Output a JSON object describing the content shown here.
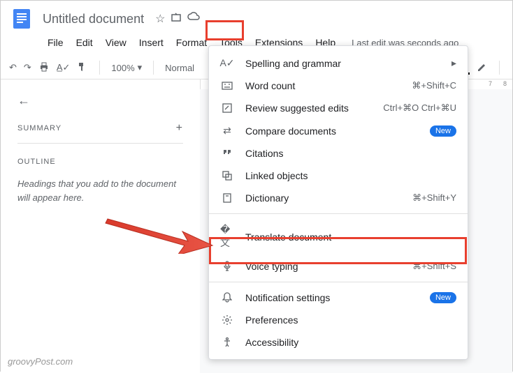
{
  "header": {
    "title": "Untitled document"
  },
  "menu": {
    "items": [
      "File",
      "Edit",
      "View",
      "Insert",
      "Format",
      "Tools",
      "Extensions",
      "Help"
    ],
    "last_edit": "Last edit was seconds ago"
  },
  "toolbar": {
    "zoom": "100%",
    "style": "Normal"
  },
  "sidebar": {
    "summary": "SUMMARY",
    "outline": "OUTLINE",
    "outline_placeholder": "Headings that you add to the document will appear here."
  },
  "ruler": {
    "nums": [
      "7",
      "8"
    ]
  },
  "dropdown": {
    "items": [
      {
        "label": "Spelling and grammar",
        "shortcut": "",
        "sub": true
      },
      {
        "label": "Word count",
        "shortcut": "⌘+Shift+C"
      },
      {
        "label": "Review suggested edits",
        "shortcut": "Ctrl+⌘O Ctrl+⌘U"
      },
      {
        "label": "Compare documents",
        "shortcut": "",
        "badge": "New"
      },
      {
        "label": "Citations",
        "shortcut": ""
      },
      {
        "label": "Linked objects",
        "shortcut": ""
      },
      {
        "label": "Dictionary",
        "shortcut": "⌘+Shift+Y"
      }
    ],
    "items2": [
      {
        "label": "Translate document",
        "shortcut": ""
      },
      {
        "label": "Voice typing",
        "shortcut": "⌘+Shift+S"
      }
    ],
    "items3": [
      {
        "label": "Notification settings",
        "shortcut": "",
        "badge": "New"
      },
      {
        "label": "Preferences",
        "shortcut": ""
      },
      {
        "label": "Accessibility",
        "shortcut": ""
      }
    ]
  },
  "watermark": "groovyPost.com"
}
